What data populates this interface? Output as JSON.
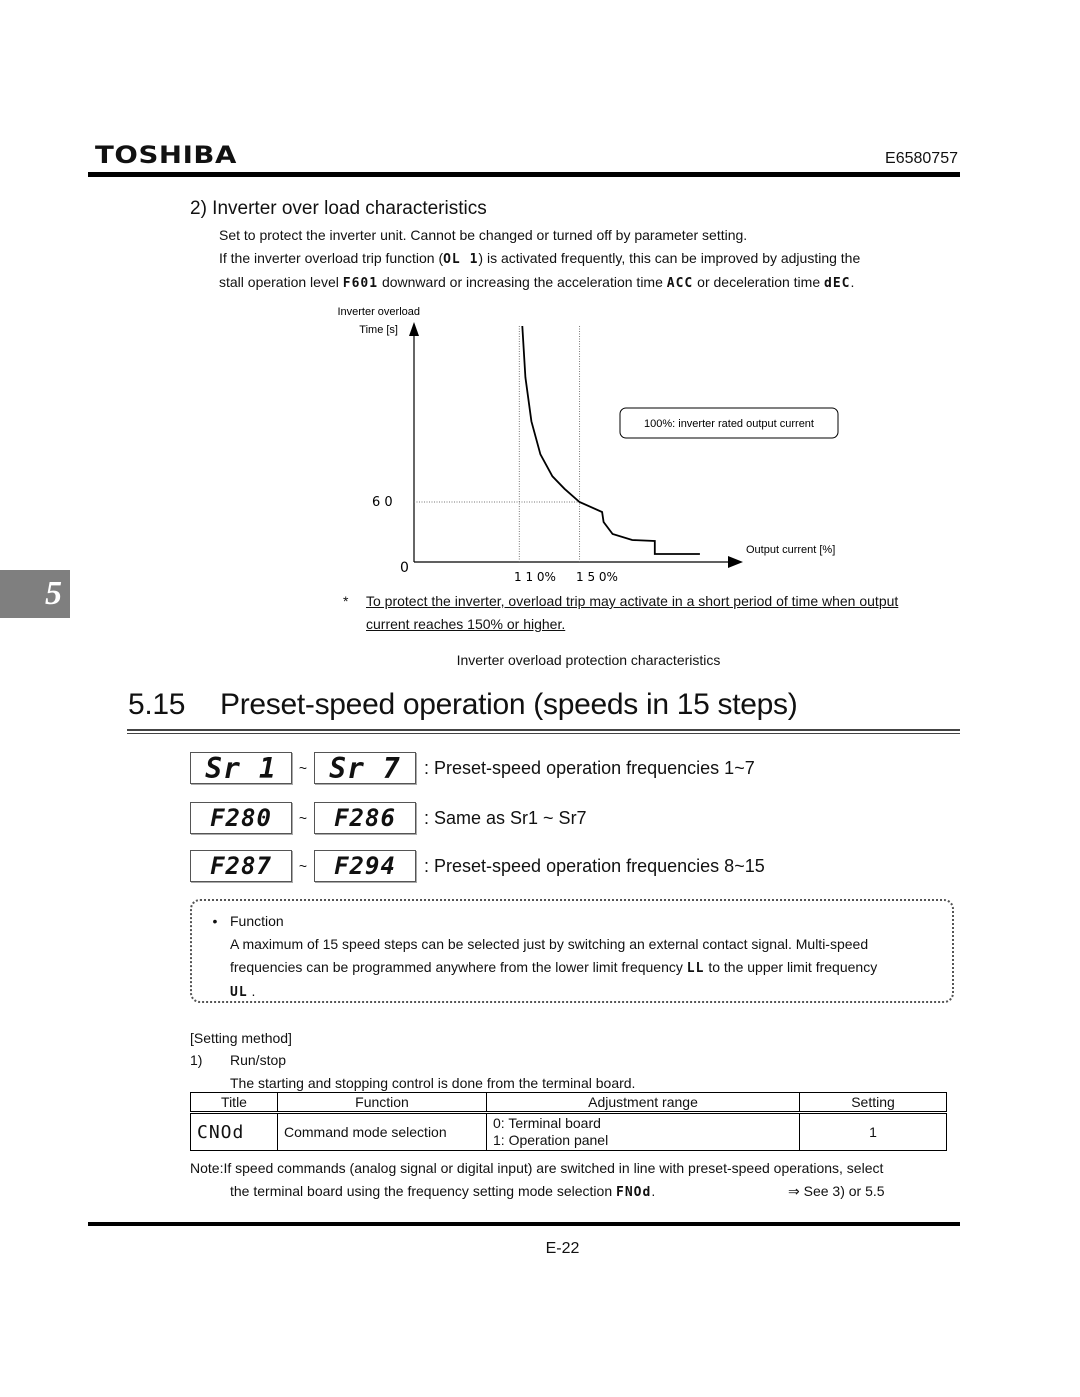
{
  "header": {
    "brand": "TOSHIBA",
    "doc_number": "E6580757"
  },
  "side_tab": {
    "chapter": "5"
  },
  "overload_section": {
    "heading": "2) Inverter over load characteristics",
    "line1": "Set to protect the inverter unit.  Cannot be changed or turned off by parameter setting.",
    "line2_a": "If the inverter overload trip function (",
    "line2_code": "OL 1",
    "line2_b": ") is activated frequently, this can be improved by adjusting the",
    "line3_a": "stall operation level",
    "line3_code1": "F601",
    "line3_b": "downward or increasing the acceleration time",
    "line3_code2": "ACC",
    "line3_c": "or deceleration time",
    "line3_code3": "dEC",
    "line3_d": "."
  },
  "chart_data": {
    "type": "line",
    "title": "Inverter overload protection characteristics",
    "ylabel_line1": "Inverter overload",
    "ylabel_line2": "Time [s]",
    "xlabel": "Output current [%]",
    "origin_label": "0",
    "y_tick_label": "6 0",
    "y_tick_value": 60,
    "x_tick_labels": [
      "1 1 0%",
      "1 5 0%"
    ],
    "x_tick_values": [
      110,
      150
    ],
    "annotation": "100%: inverter rated output current",
    "grid": false,
    "reference_lines": [
      "x=110 dotted",
      "x=150 dotted",
      "y=60 dotted"
    ],
    "series": [
      {
        "name": "overload curve",
        "points": [
          [
            112,
            300
          ],
          [
            114,
            230
          ],
          [
            118,
            170
          ],
          [
            124,
            125
          ],
          [
            132,
            95
          ],
          [
            140,
            78
          ],
          [
            150,
            60
          ],
          [
            165,
            50
          ],
          [
            166,
            40
          ],
          [
            172,
            28
          ],
          [
            185,
            22
          ],
          [
            200,
            21
          ],
          [
            200,
            8
          ],
          [
            230,
            8
          ]
        ]
      }
    ],
    "xlim": [
      40,
      250
    ],
    "ylim": [
      0,
      300
    ]
  },
  "footnote": {
    "marker": "*",
    "text_line1": "To protect the inverter, overload trip may activate in a short period of time when output",
    "text_line2": "current reaches 150% or higher."
  },
  "section": {
    "number": "5.15",
    "title": "Preset-speed operation (speeds in 15 steps)"
  },
  "params": [
    {
      "from": "Sr 1",
      "to": "Sr 7",
      "tilde": "~",
      "desc": ": Preset-speed operation frequencies 1~7"
    },
    {
      "from": "F280",
      "to": "F286",
      "tilde": "~",
      "desc": ": Same as Sr1 ~ Sr7"
    },
    {
      "from": "F287",
      "to": "F294",
      "tilde": "~",
      "desc": ": Preset-speed operation frequencies 8~15"
    }
  ],
  "function_box": {
    "bullet": "•",
    "label": "Function",
    "line1": "A maximum of 15 speed steps can be selected just by switching an external contact signal.  Multi-speed",
    "line2_a": "frequencies can be programmed anywhere from the lower limit frequency",
    "line2_code": "LL",
    "line2_b": "to the upper limit frequency",
    "line3_code": "UL",
    "line3_b": "."
  },
  "setting_method": {
    "heading": "[Setting method]",
    "step_num": "1)",
    "step_label": "Run/stop",
    "step_desc": "The starting and stopping control is done from the terminal board."
  },
  "table": {
    "headers": [
      "Title",
      "Function",
      "Adjustment range",
      "Setting"
    ],
    "rows": [
      {
        "title": "CNOd",
        "function": "Command mode selection",
        "range_line1": "0: Terminal board",
        "range_line2": "1: Operation panel",
        "setting": "1"
      }
    ]
  },
  "note": {
    "prefix": "Note:",
    "line1": "If speed commands (analog signal or digital input) are switched in line with preset-speed operations, select",
    "line2_a": "the terminal board using the frequency setting mode selection",
    "line2_code": "FNOd",
    "line2_b": ".",
    "see": "⇒ See 3) or 5.5"
  },
  "footer": {
    "page": "E-22"
  }
}
